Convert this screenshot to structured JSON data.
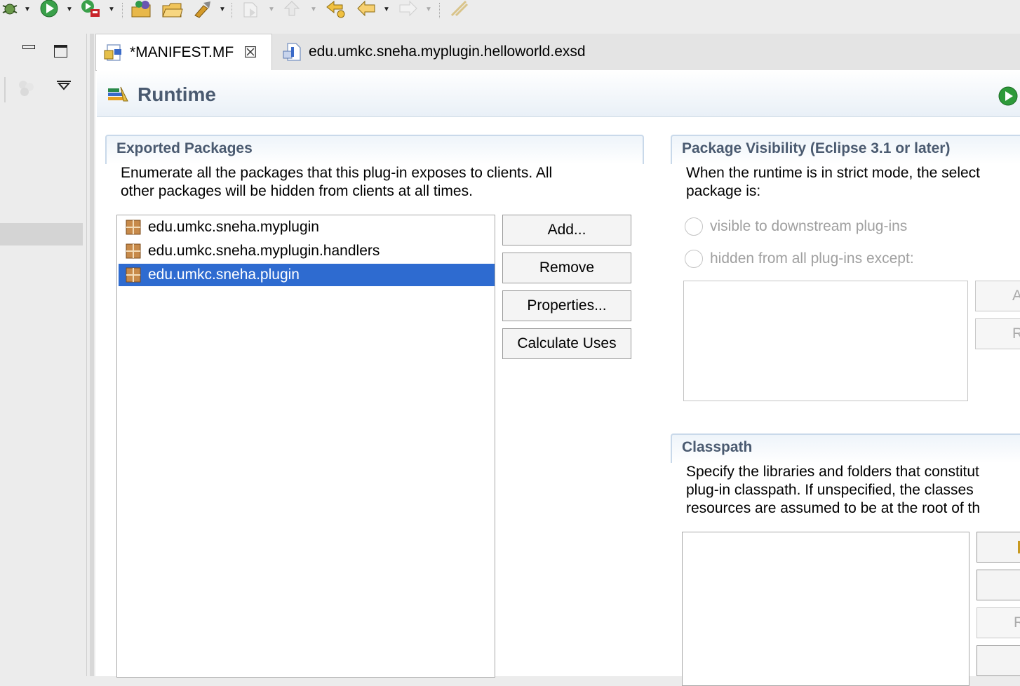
{
  "toolbar": {
    "icons": [
      "debug-icon",
      "run-icon",
      "external-tools-icon",
      "new-project-icon",
      "open-folder-icon",
      "tool-icon",
      "next-annotation-icon",
      "prev-annotation-icon",
      "last-edit-icon",
      "back-icon",
      "forward-icon",
      "pin-icon"
    ]
  },
  "tabs": [
    {
      "label": "*MANIFEST.MF",
      "active": true
    },
    {
      "label": "edu.umkc.sneha.myplugin.helloworld.exsd",
      "active": false
    }
  ],
  "form": {
    "title": "Runtime"
  },
  "exported": {
    "title": "Exported Packages",
    "desc_line1": "Enumerate all the packages that this plug-in exposes to clients.  All",
    "desc_line2": "other packages will be hidden from clients at all times.",
    "packages": [
      {
        "name": "edu.umkc.sneha.myplugin",
        "selected": false
      },
      {
        "name": "edu.umkc.sneha.myplugin.handlers",
        "selected": false
      },
      {
        "name": "edu.umkc.sneha.plugin",
        "selected": true
      }
    ],
    "buttons": {
      "add": "Add...",
      "remove": "Remove",
      "properties": "Properties...",
      "calculate": "Calculate Uses"
    }
  },
  "visibility": {
    "title": "Package Visibility (Eclipse 3.1 or later)",
    "desc_line1": "When the runtime is in strict mode, the select",
    "desc_line2": "package is:",
    "radio_visible": "visible to downstream plug-ins",
    "radio_hidden": "hidden from all plug-ins except:",
    "btn_add_partial": "A",
    "btn_remove_partial": "R"
  },
  "classpath": {
    "title": "Classpath",
    "desc_line1": "Specify the libraries and folders that constitut",
    "desc_line2": "plug-in classpath.  If unspecified, the classes",
    "desc_line3": "resources are assumed to be at the root of th",
    "btn_r_partial": "R"
  },
  "colors": {
    "selection": "#2e6bd0",
    "section_title": "#4a5a70",
    "accent_green": "#2e9a3a"
  }
}
